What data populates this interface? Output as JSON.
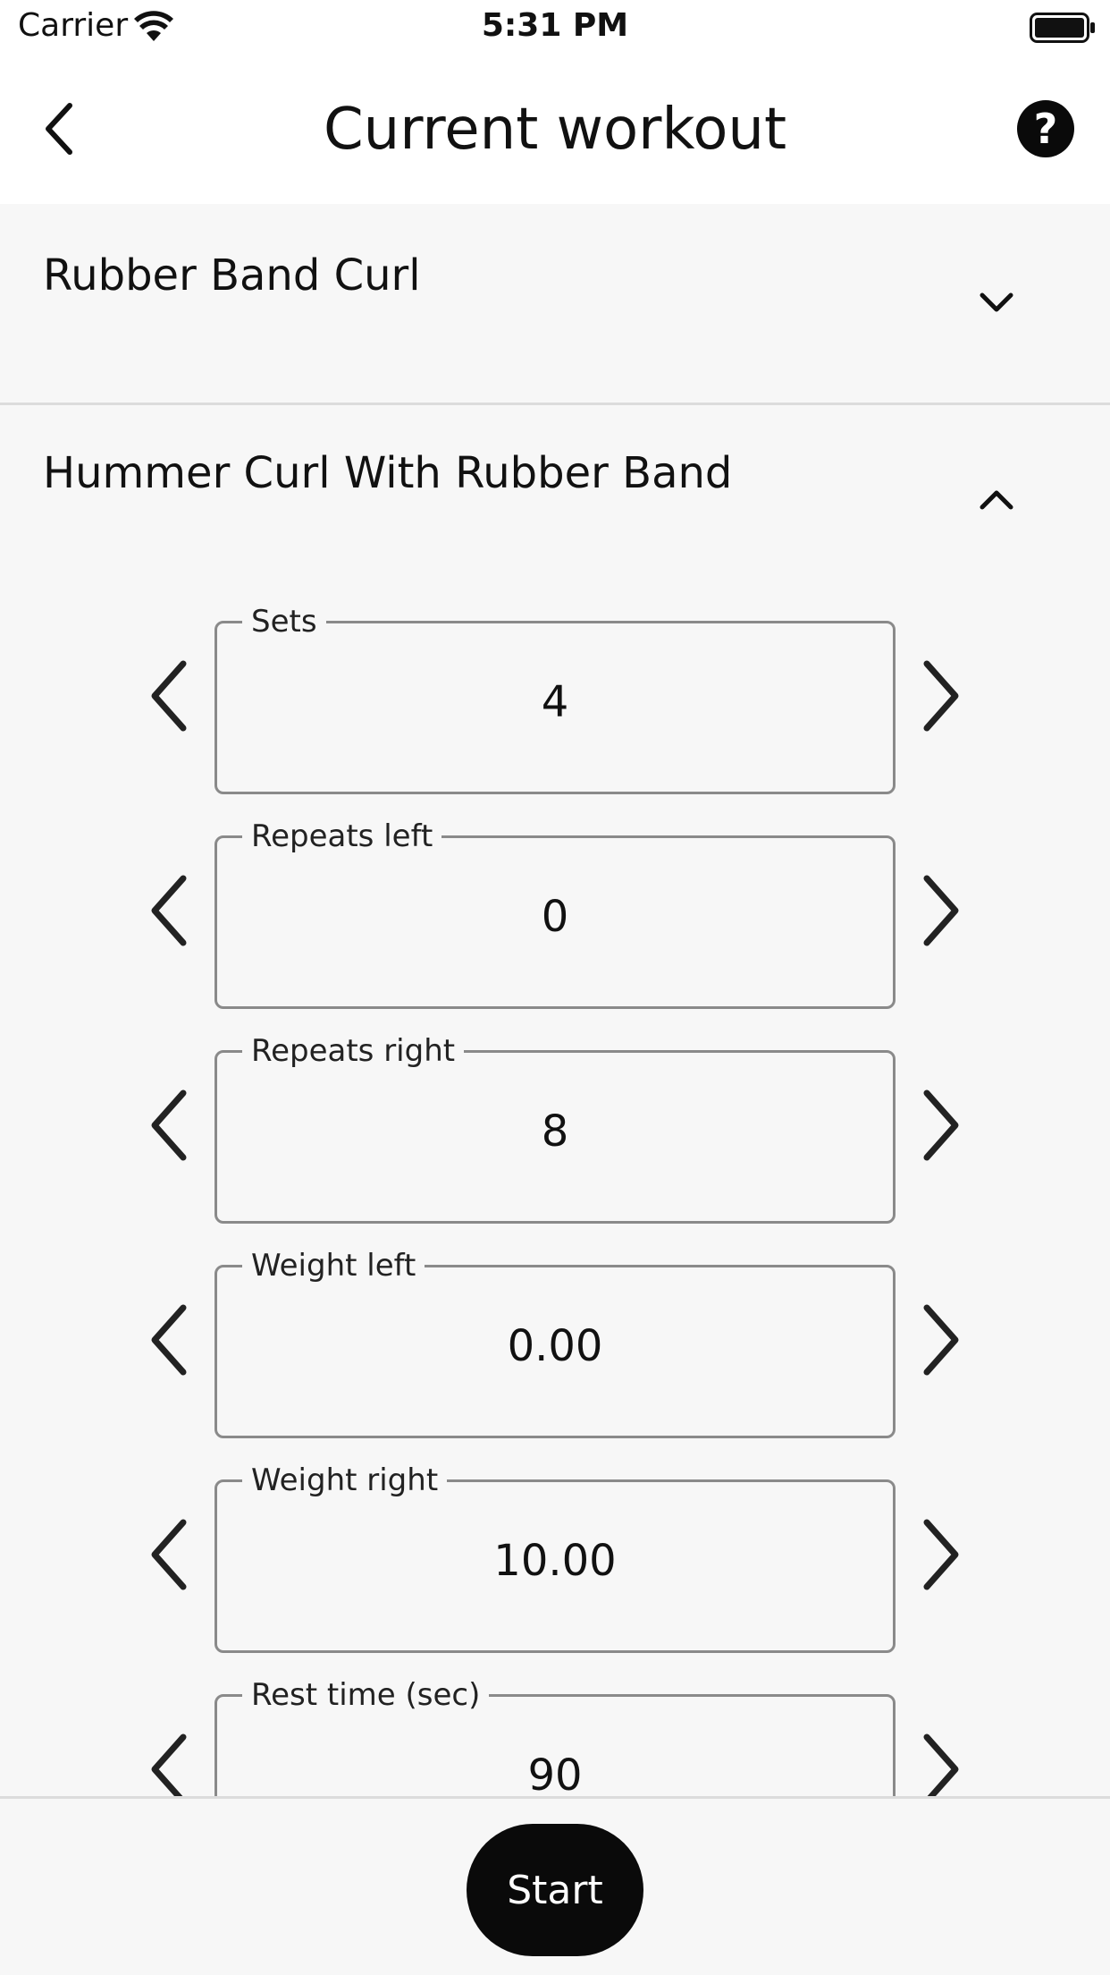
{
  "status_bar": {
    "carrier": "Carrier",
    "time": "5:31 PM",
    "wifi_icon": "wifi-icon",
    "battery_icon": "battery-icon"
  },
  "app_bar": {
    "title": "Current workout",
    "back_icon": "chevron-left-icon",
    "help_icon": "help-circle-icon",
    "help_glyph": "?"
  },
  "exercises": [
    {
      "title": "Rubber Band Curl",
      "expanded": false,
      "toggle_icon": "chevron-down-icon"
    },
    {
      "title": "Hummer Curl With Rubber Band",
      "expanded": true,
      "toggle_icon": "chevron-up-icon"
    }
  ],
  "fields": [
    {
      "label": "Sets",
      "value": "4"
    },
    {
      "label": "Repeats left",
      "value": "0"
    },
    {
      "label": "Repeats right",
      "value": "8"
    },
    {
      "label": "Weight left",
      "value": "0.00"
    },
    {
      "label": "Weight right",
      "value": "10.00"
    },
    {
      "label": "Rest time (sec)",
      "value": "90"
    }
  ],
  "bottom": {
    "start_label": "Start"
  },
  "colors": {
    "accent": "#0a0a0a",
    "background": "#f7f7f7",
    "app_bar": "#ffffff",
    "border": "#8a8a8a"
  }
}
